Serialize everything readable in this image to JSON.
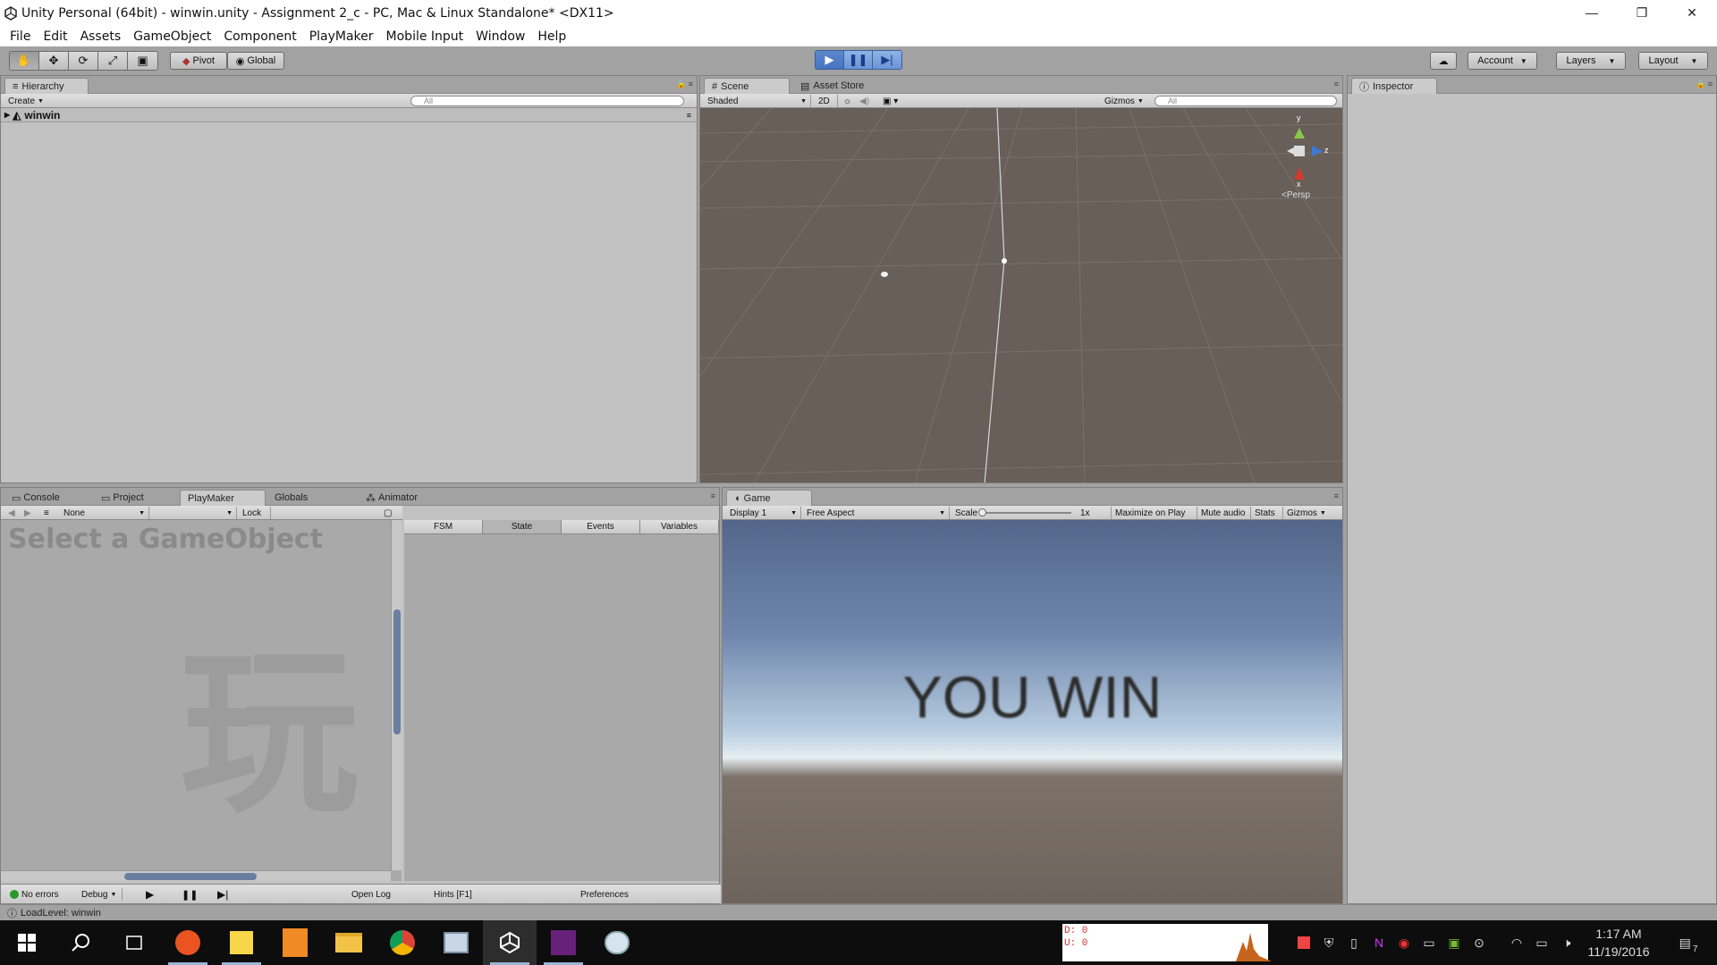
{
  "window": {
    "title": "Unity Personal (64bit) - winwin.unity - Assignment 2_c - PC, Mac & Linux Standalone* <DX11>",
    "controls": [
      "—",
      "❐",
      "✕"
    ]
  },
  "menu": [
    "File",
    "Edit",
    "Assets",
    "GameObject",
    "Component",
    "PlayMaker",
    "Mobile Input",
    "Window",
    "Help"
  ],
  "toolbar": {
    "pivot": "Pivot",
    "global": "Global",
    "account": "Account",
    "layers": "Layers",
    "layout": "Layout"
  },
  "hierarchy": {
    "tab": "Hierarchy",
    "create": "Create",
    "search_placeholder": "All",
    "scene_name": "winwin"
  },
  "scene": {
    "tab": "Scene",
    "asset_store_tab": "Asset Store",
    "shading": "Shaded",
    "mode_2d": "2D",
    "gizmos": "Gizmos",
    "search_placeholder": "All",
    "gizmo_y": "y",
    "gizmo_z": "z",
    "gizmo_x": "x",
    "persp": "Persp"
  },
  "inspector": {
    "tab": "Inspector"
  },
  "bottom_left": {
    "tabs": [
      "Console",
      "Project",
      "PlayMaker",
      "Globals",
      "Animator"
    ],
    "fsm_select": "None",
    "lock": "Lock",
    "placeholder_title": "Select a GameObject",
    "watermark_glyph": "玩",
    "headers": [
      "FSM",
      "State",
      "Events",
      "Variables"
    ],
    "no_errors": "No errors",
    "debug": "Debug",
    "open_log": "Open Log",
    "hints": "Hints [F1]",
    "preferences": "Preferences"
  },
  "game": {
    "tab": "Game",
    "display": "Display 1",
    "aspect": "Free Aspect",
    "scale_label": "Scale",
    "scale_value": "1x",
    "maximize": "Maximize on Play",
    "mute": "Mute audio",
    "stats": "Stats",
    "gizmos": "Gizmos",
    "message": "YOU WIN"
  },
  "status": {
    "message": "LoadLevel: winwin"
  },
  "taskbar": {
    "perf_d": "D: 0",
    "perf_u": "U: 0",
    "time": "1:17 AM",
    "date": "11/19/2016",
    "notification_count": "7"
  }
}
